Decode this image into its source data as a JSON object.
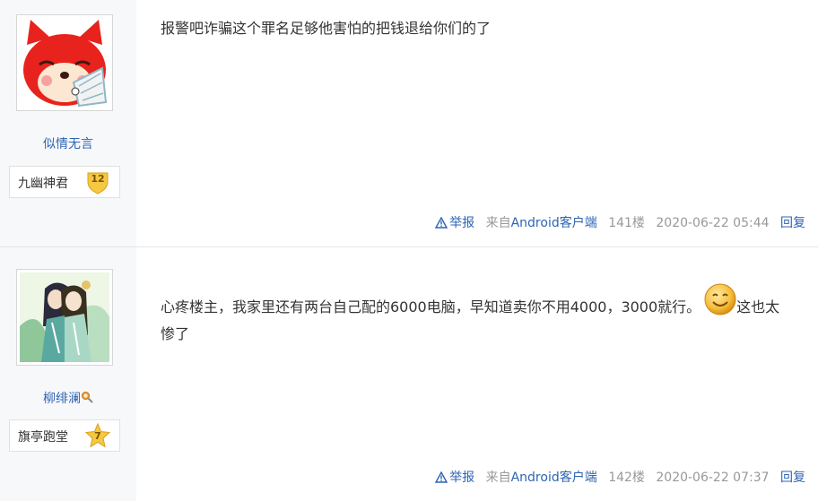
{
  "posts": [
    {
      "username": "似情无言",
      "badge": {
        "name": "九幽神君",
        "level": "12"
      },
      "content": "报警吧诈骗这个罪名足够他害怕的把钱退给你们的了",
      "content_after_emoji": "",
      "has_emoji": false,
      "tail": {
        "report": "举报",
        "client_prefix": "来自",
        "client_name": "Android客户端",
        "floor": "141楼",
        "time": "2020-06-22 05:44",
        "reply": "回复"
      }
    },
    {
      "username": "柳绯澜",
      "badge": {
        "name": "旗亭跑堂",
        "level": "7"
      },
      "content": "心疼楼主，我家里还有两台自己配的6000电脑，早知道卖你不用4000，3000就行。",
      "content_after_emoji": "这也太惨了",
      "has_emoji": true,
      "emoji_icon": "smiley-face-icon",
      "tail": {
        "report": "举报",
        "client_prefix": "来自",
        "client_name": "Android客户端",
        "floor": "142楼",
        "time": "2020-06-22 07:37",
        "reply": "回复"
      }
    }
  ],
  "colors": {
    "link": "#2d64b3",
    "meta": "#999999",
    "sidebar_bg": "#f7f8fa",
    "badge_gold": "#f5c842"
  }
}
